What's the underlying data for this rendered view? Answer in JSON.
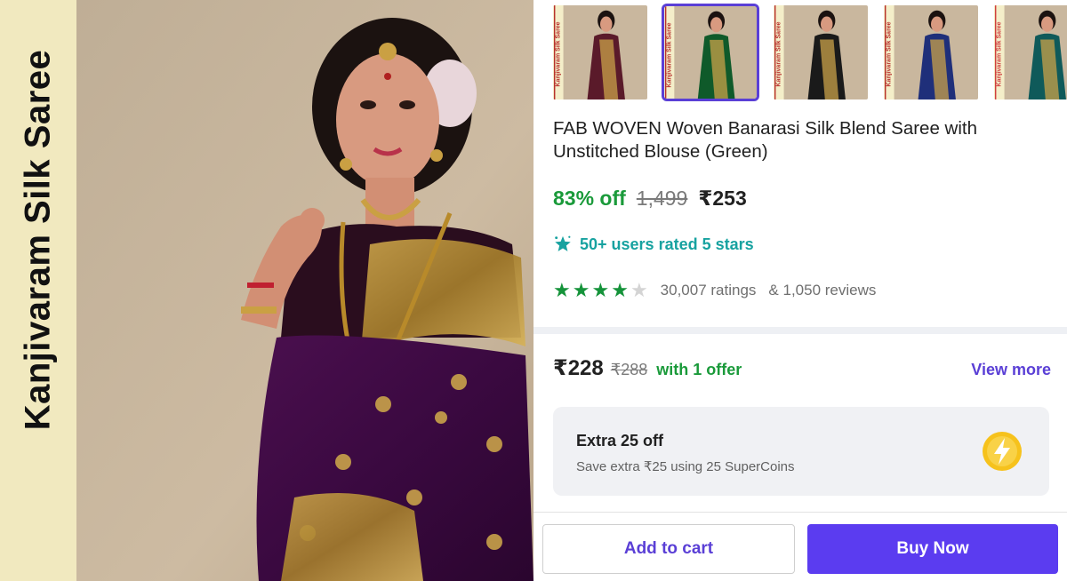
{
  "hero": {
    "side_label": "Kanjivaram Silk Saree",
    "thumbnail_label": "Kanjivaram Silk Saree"
  },
  "product": {
    "title": "FAB WOVEN Woven Banarasi Silk Blend Saree with Unstitched Blouse (Green)",
    "discount": "83% off",
    "mrp": "1,499",
    "price": "₹253",
    "users_rated": "50+ users rated 5 stars",
    "rating_stars": 4,
    "ratings": "30,007 ratings",
    "reviews": "& 1,050 reviews"
  },
  "offer": {
    "price": "₹228",
    "mrp": "₹288",
    "text": "with 1 offer",
    "view_more": "View more"
  },
  "supercoins": {
    "title": "Extra 25 off",
    "subtitle": "Save extra ₹25 using 25 SuperCoins"
  },
  "actions": {
    "add_to_cart": "Add to cart",
    "buy_now": "Buy Now"
  },
  "colors": {
    "accent": "#5b3cf0",
    "discount_green": "#1a9a3a",
    "rated_teal": "#17a2a0",
    "star_green": "#15933a"
  },
  "thumbnails": [
    {
      "saree": "#5a1a2a",
      "border": "#b8322e",
      "selected": false
    },
    {
      "saree": "#0f5a2a",
      "border": "#b8322e",
      "selected": true
    },
    {
      "saree": "#1a1a1a",
      "border": "#b8322e",
      "selected": false
    },
    {
      "saree": "#1f2f7a",
      "border": "#b8322e",
      "selected": false
    },
    {
      "saree": "#0f5a5a",
      "border": "#d04040",
      "selected": false
    }
  ]
}
